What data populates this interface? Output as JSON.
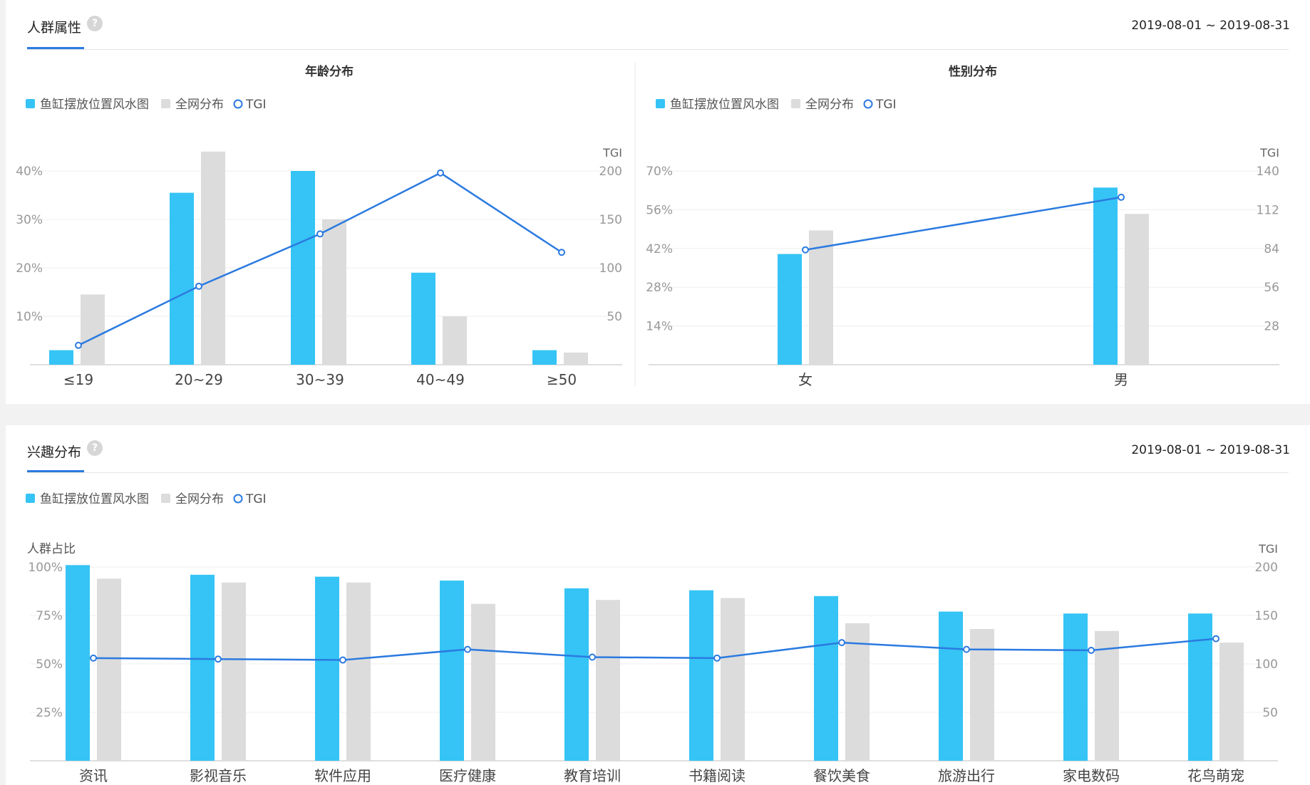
{
  "sections": {
    "crowd": {
      "title": "人群属性",
      "date_range": "2019-08-01 ~ 2019-08-31",
      "help_icon": "?"
    },
    "interest": {
      "title": "兴趣分布",
      "date_range": "2019-08-01 ~ 2019-08-31",
      "help_icon": "?"
    }
  },
  "legend": {
    "series1": "鱼缸摆放位置风水图",
    "series2": "全网分布",
    "series3": "TGI"
  },
  "colors": {
    "series1": "#35c4f5",
    "series2": "#dcdcdc",
    "tgi": "#2b7ae0",
    "accent": "#2b7ae0"
  },
  "chart_data": [
    {
      "type": "bar",
      "title": "年龄分布",
      "categories": [
        "≤19",
        "20~29",
        "30~39",
        "40~49",
        "≥50"
      ],
      "series": [
        {
          "name": "鱼缸摆放位置风水图",
          "values": [
            3,
            35.5,
            40,
            19,
            3
          ]
        },
        {
          "name": "全网分布",
          "values": [
            14.5,
            44,
            30,
            10,
            2.5
          ]
        },
        {
          "name": "TGI",
          "axis": "right",
          "values": [
            20,
            81,
            135,
            198,
            116
          ]
        }
      ],
      "ylim": [
        0,
        40
      ],
      "yticks": [
        "10%",
        "20%",
        "30%",
        "40%"
      ],
      "ytick_values": [
        10,
        20,
        30,
        40
      ],
      "y2label": "TGI",
      "y2lim": [
        0,
        200
      ],
      "y2ticks": [
        "50",
        "100",
        "150",
        "200"
      ],
      "y2tick_values": [
        50,
        100,
        150,
        200
      ],
      "grid": true,
      "legend": "top-left"
    },
    {
      "type": "bar",
      "title": "性别分布",
      "categories": [
        "女",
        "男"
      ],
      "series": [
        {
          "name": "鱼缸摆放位置风水图",
          "values": [
            40,
            64
          ]
        },
        {
          "name": "全网分布",
          "values": [
            48.5,
            54.5
          ]
        },
        {
          "name": "TGI",
          "axis": "right",
          "values": [
            83,
            121
          ]
        }
      ],
      "ylim": [
        0,
        70
      ],
      "yticks": [
        "14%",
        "28%",
        "42%",
        "56%",
        "70%"
      ],
      "ytick_values": [
        14,
        28,
        42,
        56,
        70
      ],
      "y2label": "TGI",
      "y2lim": [
        0,
        140
      ],
      "y2ticks": [
        "28",
        "56",
        "84",
        "112",
        "140"
      ],
      "y2tick_values": [
        28,
        56,
        84,
        112,
        140
      ],
      "grid": true,
      "legend": "top-left"
    },
    {
      "type": "bar",
      "title": "",
      "categories": [
        "资讯",
        "影视音乐",
        "软件应用",
        "医疗健康",
        "教育培训",
        "书籍阅读",
        "餐饮美食",
        "旅游出行",
        "家电数码",
        "花鸟萌宠"
      ],
      "series": [
        {
          "name": "鱼缸摆放位置风水图",
          "values": [
            101,
            96,
            95,
            93,
            89,
            88,
            85,
            77,
            76,
            76
          ]
        },
        {
          "name": "全网分布",
          "values": [
            94,
            92,
            92,
            81,
            83,
            84,
            71,
            68,
            67,
            61
          ]
        },
        {
          "name": "TGI",
          "axis": "right",
          "values": [
            106,
            105,
            104,
            115,
            107,
            106,
            122,
            115,
            114,
            126
          ]
        }
      ],
      "ylabel": "人群占比",
      "ylim": [
        0,
        100
      ],
      "yticks": [
        "25%",
        "50%",
        "75%",
        "100%"
      ],
      "ytick_values": [
        25,
        50,
        75,
        100
      ],
      "y2label": "TGI",
      "y2lim": [
        0,
        200
      ],
      "y2ticks": [
        "50",
        "100",
        "150",
        "200"
      ],
      "y2tick_values": [
        50,
        100,
        150,
        200
      ],
      "grid": true,
      "legend": "top-left"
    }
  ]
}
